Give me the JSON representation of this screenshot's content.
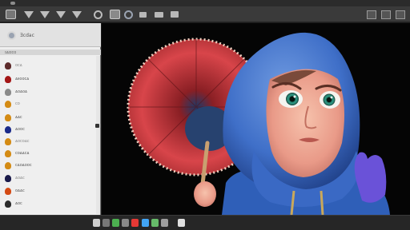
{
  "window": {
    "title": ""
  },
  "toolbar": {
    "tools": [
      {
        "name": "select-icon"
      },
      {
        "name": "brush-icon"
      },
      {
        "name": "eraser-icon"
      },
      {
        "name": "fill-icon"
      },
      {
        "name": "gradient-icon"
      },
      {
        "name": "image-icon"
      },
      {
        "name": "ellipse-icon"
      },
      {
        "name": "layers-icon"
      },
      {
        "name": "comment-icon"
      },
      {
        "name": "view-icon"
      },
      {
        "name": "settings-icon"
      }
    ]
  },
  "sidebar": {
    "header": "Ǝᴄdac",
    "section": "ɪᴀɪɪᴄᴏ",
    "layers": [
      {
        "label": "ᴏᴄᴀ",
        "color": "#5c2a2a"
      },
      {
        "label": "ᴀᴇᴏᴏᴄᴀ",
        "color": "#a31515"
      },
      {
        "label": "ᴀᴏᴀᴏᴀ",
        "color": "#8a8a8a"
      },
      {
        "label": "ᴄᴏ",
        "color": "#d48b14"
      },
      {
        "label": "ᴀᴀᴄ",
        "color": "#d48b14"
      },
      {
        "label": "ᴀᴏᴏᴄ",
        "color": "#1a2a8a"
      },
      {
        "label": "ᴀᴏᴄᴏᴀᴄ",
        "color": "#d48b14"
      },
      {
        "label": "ᴄᴏᴀᴀᴄᴀ",
        "color": "#d48b14"
      },
      {
        "label": "ᴄᴀᴏᴀᴏᴏᴄ",
        "color": "#d48b14"
      },
      {
        "label": "ᴀᴏᴀᴄ",
        "color": "#1a1a4a"
      },
      {
        "label": "ᴏᴀᴀᴄ",
        "color": "#d44a14"
      },
      {
        "label": "ᴀᴏᴄ",
        "color": "#2a2a2a"
      }
    ]
  },
  "statusbar": {
    "buttons": [
      {
        "name": "tool-a-icon",
        "color": "#cfcfcf"
      },
      {
        "name": "tool-b-icon",
        "color": "#777777"
      },
      {
        "name": "tool-c-icon",
        "color": "#4caf50"
      },
      {
        "name": "tool-d-icon",
        "color": "#8a8a8a"
      },
      {
        "name": "tool-e-icon",
        "color": "#e53935"
      },
      {
        "name": "tool-f-icon",
        "color": "#42a5f5"
      },
      {
        "name": "tool-g-icon",
        "color": "#66bb6a"
      },
      {
        "name": "tool-h-icon",
        "color": "#9e9e9e"
      },
      {
        "name": "tool-i-icon",
        "color": "#e0e0e0"
      }
    ]
  },
  "canvas": {
    "image": "3d-character-illustration"
  }
}
